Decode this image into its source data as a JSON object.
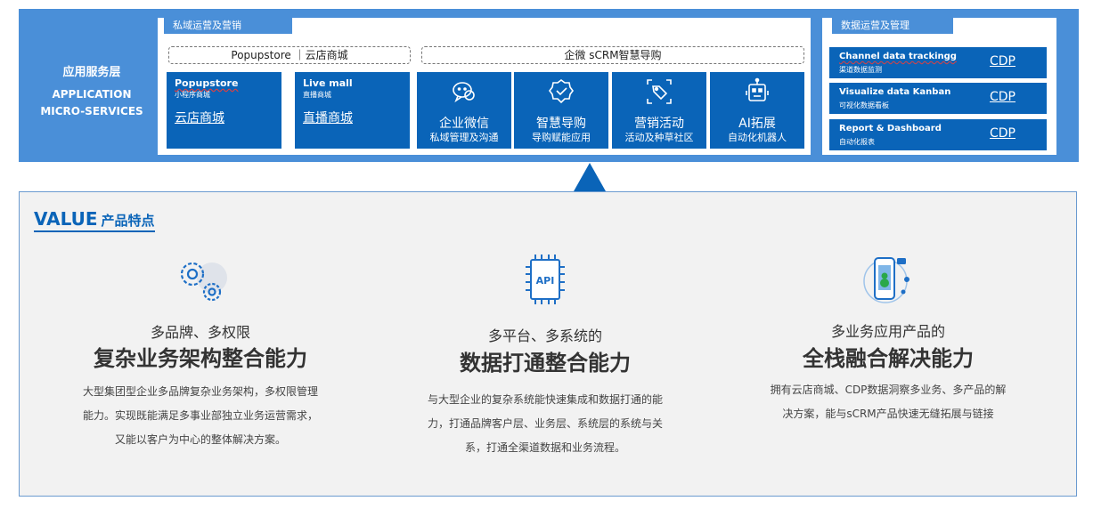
{
  "app_layer": {
    "cn": "应用服务层",
    "en_line1": "APPLICATION",
    "en_line2": "MICRO-SERVICES"
  },
  "private_ops": {
    "tag": "私域运营及营销",
    "dashed_left": "Popupstore ｜云店商城",
    "dashed_right": "企微 sCRM智慧导购",
    "malls": [
      {
        "en": "Popupstore",
        "sub": "小程序商城",
        "link": "云店商城"
      },
      {
        "en": "Live mall",
        "sub": "直播商城",
        "link": "直播商城"
      }
    ],
    "features": [
      {
        "icon": "wechat-chat-icon",
        "title": "企业微信",
        "sub": "私域管理及沟通"
      },
      {
        "icon": "smart-guide-badge-icon",
        "title": "智慧导购",
        "sub": "导购赋能应用"
      },
      {
        "icon": "marketing-tag-icon",
        "title": "营销活动",
        "sub": "活动及种草社区"
      },
      {
        "icon": "robot-icon",
        "title": "AI拓展",
        "sub": "自动化机器人"
      }
    ]
  },
  "data_ops": {
    "tag": "数据运营及管理",
    "rows": [
      {
        "en": "Channel data trackingg",
        "sub": "渠道数据监测",
        "link": "CDP"
      },
      {
        "en": "Visualize data Kanban",
        "sub": "可视化数据看板",
        "link": "CDP"
      },
      {
        "en": "Report & Dashboard",
        "sub": "自动化报表",
        "link": "CDP"
      }
    ]
  },
  "value": {
    "title_en": "VALUE",
    "title_cn": "产品特点",
    "columns": [
      {
        "icon": "gears-icon",
        "small": "多品牌、多权限",
        "big": "复杂业务架构整合能力",
        "desc": "大型集团型企业多品牌复杂业务架构，多权限管理能力。实现既能满足多事业部独立业务运营需求，又能以客户为中心的整体解决方案。"
      },
      {
        "icon": "api-chip-icon",
        "small": "多平台、多系统的",
        "big": "数据打通整合能力",
        "desc": "与大型企业的复杂系统能快速集成和数据打通的能力，打通品牌客户层、业务层、系统层的系统与关系，打通全渠道数据和业务流程。"
      },
      {
        "icon": "phone-apps-icon",
        "small": "多业务应用产品的",
        "big": "全栈融合解决能力",
        "desc": "拥有云店商城、CDP数据洞察多业务、多产品的解决方案，能与sCRM产品快速无缝拓展与链接"
      }
    ]
  },
  "colors": {
    "band": "#4a8fd8",
    "card": "#0a64b8",
    "value_bg": "#f2f2f2"
  }
}
